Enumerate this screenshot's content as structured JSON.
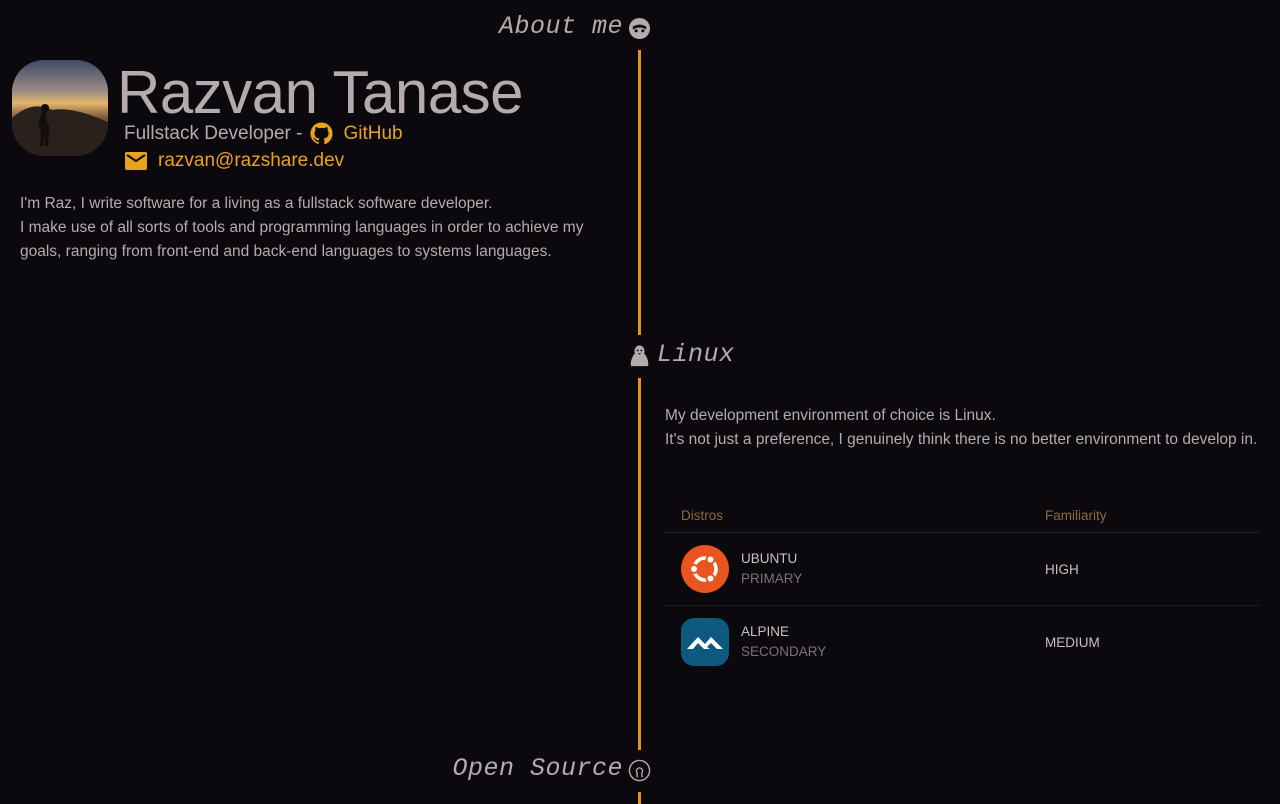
{
  "about": {
    "title": "About me",
    "name": "Razvan Tanase",
    "role": "Fullstack Developer -",
    "github_label": "GitHub",
    "email": "razvan@razshare.dev",
    "bio_lines": [
      "I'm Raz, I write software for a living as a fullstack software developer.",
      "I make use of all sorts of tools and programming languages in order to achieve my goals, ranging from front-end and back-end languages to systems languages."
    ]
  },
  "linux": {
    "title": "Linux",
    "intro_lines": [
      "My development environment of choice is Linux.",
      "It's not just a preference, I genuinely think there is no better environment to develop in."
    ],
    "table": {
      "headers": [
        "Distros",
        "Familiarity"
      ],
      "rows": [
        {
          "name": "UBUNTU",
          "role": "PRIMARY",
          "familiarity": "HIGH",
          "logo": "ubuntu-logo",
          "color": "#e95420"
        },
        {
          "name": "ALPINE",
          "role": "SECONDARY",
          "familiarity": "MEDIUM",
          "logo": "alpine-logo",
          "color": "#0d597f"
        }
      ]
    }
  },
  "open_source": {
    "title": "Open Source"
  },
  "colors": {
    "accent": "#e8a21f",
    "background": "#0b090e",
    "text": "#b6abab"
  },
  "icons": {
    "about": "face-icon",
    "linux": "penguin-icon",
    "open_source": "open-source-icon",
    "github": "github-icon",
    "email": "envelope-icon"
  }
}
